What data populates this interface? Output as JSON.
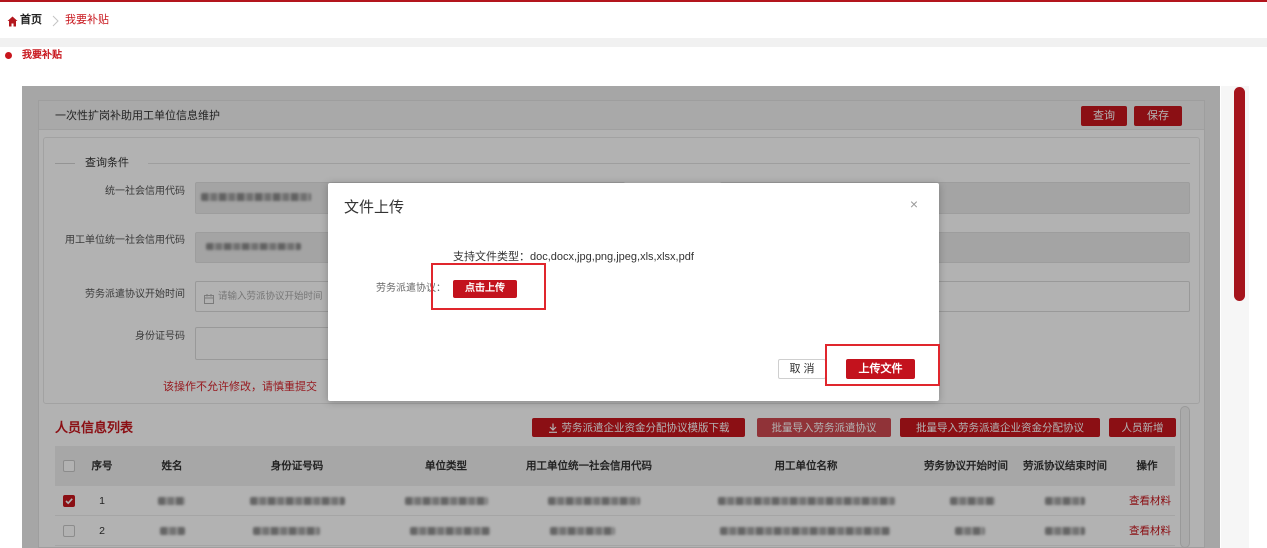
{
  "theme": {
    "accent": "#c8161d"
  },
  "icons": {
    "home": "home-icon",
    "separator": "chevron-right-icon",
    "calendar": "calendar-icon",
    "download": "download-icon",
    "checkbox_check": "check-icon"
  },
  "breadcrumb": {
    "home": "首页",
    "current": "我要补贴"
  },
  "section": {
    "title": "我要补贴"
  },
  "panel": {
    "title": "一次性扩岗补助用工单位信息维护",
    "query_button": "查询",
    "save_button": "保存"
  },
  "query": {
    "title": "查询条件",
    "credit_code_label": "统一社会信用代码",
    "employer_credit_code_label": "用工单位统一社会信用代码",
    "agreement_start_label": "劳务派遣协议开始时间",
    "agreement_start_placeholder": "请输入劳派协议开始时间",
    "id_number_label": "身份证号码",
    "warning": "该操作不允许修改，请慎重提交"
  },
  "list": {
    "title": "人员信息列表",
    "download_button": "劳务派遣企业资金分配协议模版下载",
    "import_agreement_button": "批量导入劳务派遣协议",
    "import_fund_button": "批量导入劳务派遣企业资金分配协议",
    "add_button": "人员新增"
  },
  "table": {
    "columns": [
      "序号",
      "姓名",
      "身份证号码",
      "单位类型",
      "用工单位统一社会信用代码",
      "用工单位名称",
      "劳务协议开始时间",
      "劳派协议结束时间",
      "操作"
    ],
    "rows": [
      {
        "index": "1",
        "selected": true,
        "action": "查看材料"
      },
      {
        "index": "2",
        "selected": false,
        "action": "查看材料"
      }
    ]
  },
  "modal": {
    "title": "文件上传",
    "close": "×",
    "file_types": "支持文件类型：doc,docx,jpg,png,jpeg,xls,xlsx,pdf",
    "upload_label": "劳务派遣协议：",
    "upload_button": "点击上传",
    "cancel_button": "取 消",
    "submit_button": "上传文件"
  }
}
